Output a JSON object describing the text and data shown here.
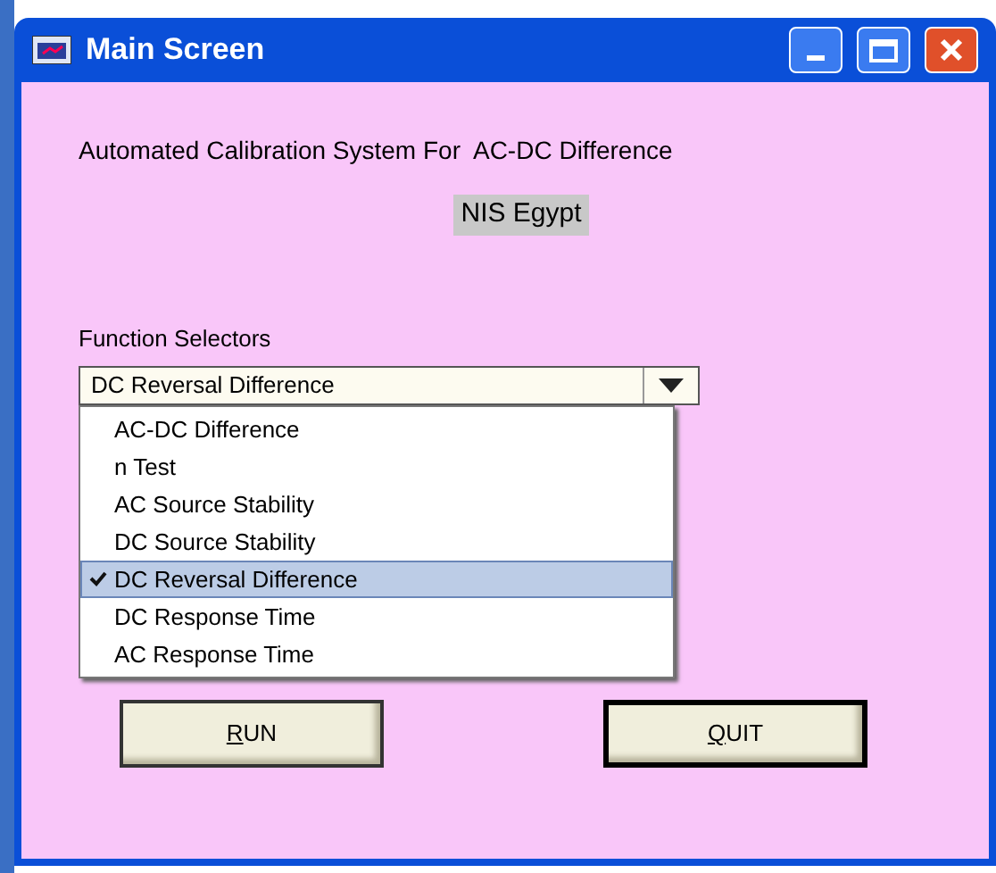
{
  "window": {
    "title": "Main Screen"
  },
  "heading": "Automated Calibration System For  AC-DC Difference",
  "organization": "NIS Egypt",
  "function_selector": {
    "label": "Function Selectors",
    "value": "DC Reversal Difference",
    "expanded": true,
    "options": [
      {
        "label": "AC-DC Difference",
        "selected": false
      },
      {
        "label": "n Test",
        "selected": false
      },
      {
        "label": "AC Source Stability",
        "selected": false
      },
      {
        "label": "DC Source Stability",
        "selected": false
      },
      {
        "label": "DC Reversal Difference",
        "selected": true
      },
      {
        "label": "DC Response Time",
        "selected": false
      },
      {
        "label": "AC Response Time",
        "selected": false
      }
    ]
  },
  "buttons": [
    {
      "label": "RUN",
      "default": false
    },
    {
      "label": "QUIT",
      "default": true
    }
  ]
}
